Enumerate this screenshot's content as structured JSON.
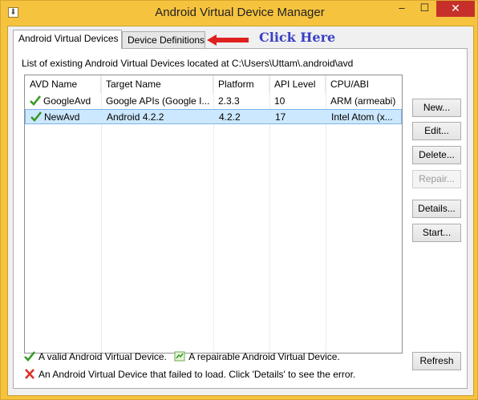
{
  "window": {
    "title": "Android Virtual Device Manager",
    "system_icon": "download-arrow-icon",
    "min_glyph": "–",
    "max_glyph": "☐",
    "close_glyph": "✕"
  },
  "tabs": [
    {
      "label": "Android Virtual Devices",
      "active": true
    },
    {
      "label": "Device Definitions",
      "active": false
    }
  ],
  "annotation": {
    "text": "Click Here",
    "color": "#3a3fc4",
    "arrow_color": "#e02020"
  },
  "avd_panel": {
    "path_label": "List of existing Android Virtual Devices located at C:\\Users\\Uttam\\.android\\avd",
    "columns": [
      "AVD Name",
      "Target Name",
      "Platform",
      "API Level",
      "CPU/ABI"
    ],
    "rows": [
      {
        "name": "GoogleAvd",
        "target": "Google APIs (Google I...",
        "platform": "2.3.3",
        "api": "10",
        "cpu": "ARM (armeabi)",
        "status": "valid",
        "selected": false
      },
      {
        "name": "NewAvd",
        "target": "Android 4.2.2",
        "platform": "4.2.2",
        "api": "17",
        "cpu": "Intel Atom (x...",
        "status": "valid",
        "selected": true
      }
    ],
    "buttons": {
      "new": "New...",
      "edit": "Edit...",
      "delete": "Delete...",
      "repair": "Repair...",
      "details": "Details...",
      "start": "Start...",
      "refresh": "Refresh"
    },
    "legend": {
      "valid": "A valid Android Virtual Device.",
      "repairable": "A repairable Android Virtual Device.",
      "failed": "An Android Virtual Device that failed to load. Click 'Details' to see the error."
    }
  },
  "colors": {
    "titlebar": "#f6c33f",
    "close_button": "#c7302a",
    "selection": "#cce8ff",
    "check": "#3a9a2a",
    "error_x": "#d9342b"
  }
}
